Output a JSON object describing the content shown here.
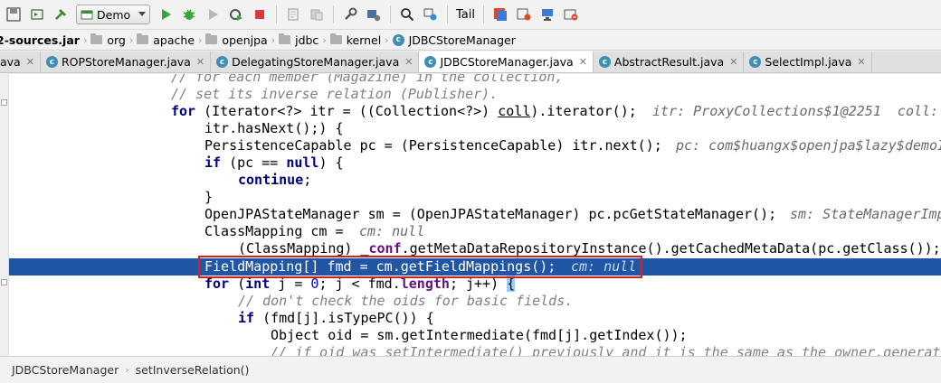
{
  "toolbar": {
    "run_config": "Demo",
    "tail_label": "Tail"
  },
  "breadcrumb": {
    "items": [
      "2-sources.jar",
      "org",
      "apache",
      "openjpa",
      "jdbc",
      "kernel",
      "JDBCStoreManager"
    ]
  },
  "tabs": [
    {
      "label": "ava",
      "icon": "class-icon",
      "active": false
    },
    {
      "label": "ROPStoreManager.java",
      "icon": "class-icon",
      "active": false
    },
    {
      "label": "DelegatingStoreManager.java",
      "icon": "class-icon",
      "active": false
    },
    {
      "label": "JDBCStoreManager.java",
      "icon": "class-icon",
      "active": true
    },
    {
      "label": "AbstractResult.java",
      "icon": "class-icon",
      "active": false
    },
    {
      "label": "SelectImpl.java",
      "icon": "class-icon",
      "active": false
    }
  ],
  "code": {
    "line1": "// for each member (Magazine) in the collection,",
    "line2": "// set its inverse relation (Publisher).",
    "line3_kw": "for",
    "line3_a": " (Iterator<?> itr = ((Collection<?>) ",
    "line3_coll": "coll",
    "line3_b": ").iterator();",
    "line3_dbg": "itr: ProxyCollections$1@2251  coll: ",
    "line4": "itr.hasNext();) {",
    "line5_code": "PersistenceCapable pc = (PersistenceCapable) itr.next();",
    "line5_dbg": "pc: com$huangx$openjpa$lazy$demoI",
    "line6_kw": "if",
    "line6_a": " (pc == ",
    "line6_null": "null",
    "line6_b": ") {",
    "line7_kw": "continue",
    "line7_b": ";",
    "line8": "}",
    "line9_code": "OpenJPAStateManager sm = (OpenJPAStateManager) pc.pcGetStateManager();",
    "line9_dbg": "sm: StateManagerImp",
    "line10_code": "ClassMapping cm =",
    "line10_dbg": "cm: null",
    "line11_a": "(ClassMapping) ",
    "line11_conf": "_conf",
    "line11_b": ".getMetaDataRepositoryInstance().getCachedMetaData(pc.getClass());",
    "line12_code": "FieldMapping[] fmd = cm.getFieldMappings();",
    "line12_dbg": "cm: null",
    "line13_kw1": "for",
    "line13_a": " (",
    "line13_kw2": "int",
    "line13_b": " j = ",
    "line13_zero": "0",
    "line13_c": "; j < fmd.",
    "line13_length": "length",
    "line13_d": "; j++) ",
    "line13_brace": "{",
    "line14": "// don't check the oids for basic fields.",
    "line15_kw": "if",
    "line15_a": " (fmd[j].isTypePC()) {",
    "line16": "Object oid = sm.getIntermediate(fmd[j].getIndex());",
    "line17": "// if oid was setIntermediate() previously and it is the same as the owner,generate"
  },
  "statusbar": {
    "items": [
      "JDBCStoreManager",
      "setInverseRelation()"
    ]
  },
  "colors": {
    "execution_line": "#2156a5",
    "highlight_box": "#d42020",
    "keyword": "#000080",
    "comment": "#808080",
    "field": "#660e7a",
    "number": "#0000ff"
  }
}
